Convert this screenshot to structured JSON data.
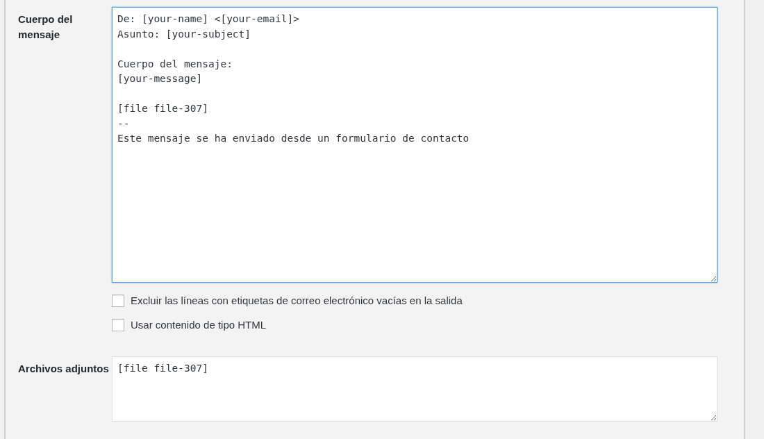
{
  "fields": [
    {
      "kind": "textarea",
      "label": "Cuerpo del mensaje",
      "value": "De: [your-name] <[your-email]>\nAsunto: [your-subject]\n\nCuerpo del mensaje:\n[your-message]\n\n[file file-307]\n--\nEste mensaje se ha enviado desde un formulario de contacto",
      "focused": true,
      "options": [
        {
          "label": "Excluir las líneas con etiquetas de correo electrónico vacías en la salida",
          "checked": false
        },
        {
          "label": "Usar contenido de tipo HTML",
          "checked": false
        }
      ]
    },
    {
      "kind": "textarea",
      "label": "Archivos adjuntos",
      "value": "[file file-307]",
      "focused": false
    }
  ]
}
